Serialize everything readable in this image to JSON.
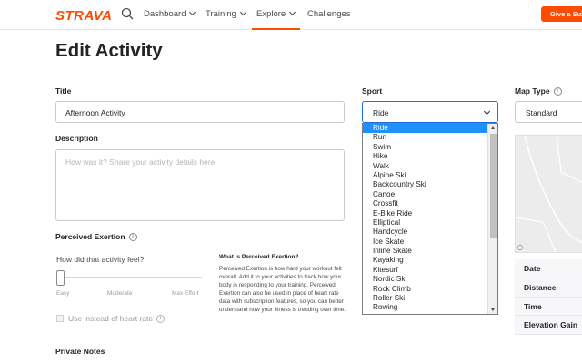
{
  "brand": {
    "logo": "STRAVA",
    "accent": "#fc4c02"
  },
  "nav": {
    "items": [
      {
        "label": "Dashboard",
        "has_menu": true
      },
      {
        "label": "Training",
        "has_menu": true
      },
      {
        "label": "Explore",
        "has_menu": true,
        "active": true
      },
      {
        "label": "Challenges",
        "has_menu": false
      }
    ],
    "give_button": "Give a Sub"
  },
  "page": {
    "title": "Edit Activity"
  },
  "form": {
    "title_label": "Title",
    "title_value": "Afternoon Activity",
    "description_label": "Description",
    "description_placeholder": "How was it? Share your activity details here.",
    "perceived_exertion_label": "Perceived Exertion",
    "feel_question": "How did that activity feel?",
    "slider_labels": {
      "easy": "Easy",
      "moderate": "Moderate",
      "max": "Max Effort"
    },
    "use_hr_label": "Use instead of heart rate",
    "pe_info_title": "What is Perceived Exertion?",
    "pe_info_body": "Perceived Exertion is how hard your workout felt overall. Add it to your activities to track how your body is responding to your training. Perceived Exertion can also be used in place of heart rate data with subscription features, so you can better understand how your fitness is trending over time.",
    "private_notes_label": "Private Notes"
  },
  "sport": {
    "label": "Sport",
    "selected": "Ride",
    "options": [
      "Ride",
      "Run",
      "Swim",
      "Hike",
      "Walk",
      "Alpine Ski",
      "Backcountry Ski",
      "Canoe",
      "Crossfit",
      "E-Bike Ride",
      "Elliptical",
      "Handcycle",
      "Ice Skate",
      "Inline Skate",
      "Kayaking",
      "Kitesurf",
      "Nordic Ski",
      "Rock Climb",
      "Roller Ski",
      "Rowing"
    ]
  },
  "map": {
    "label": "Map Type",
    "value": "Standard"
  },
  "stats": [
    "Date",
    "Distance",
    "Time",
    "Elevation Gain"
  ]
}
